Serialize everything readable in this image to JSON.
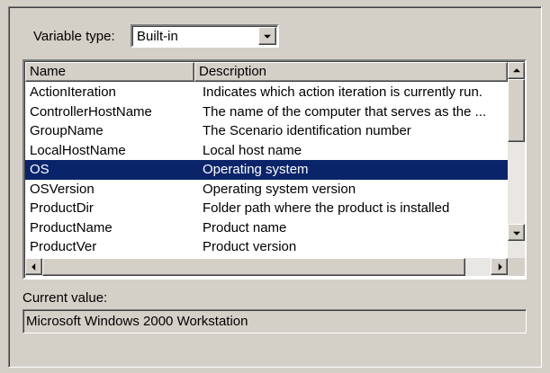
{
  "variable_type": {
    "label": "Variable type:",
    "selected": "Built-in"
  },
  "table": {
    "columns": [
      "Name",
      "Description"
    ],
    "rows": [
      {
        "name": "ActionIteration",
        "description": "Indicates which action iteration is currently run."
      },
      {
        "name": "ControllerHostName",
        "description": "The name of the computer that serves as the ..."
      },
      {
        "name": "GroupName",
        "description": "The Scenario identification number"
      },
      {
        "name": "LocalHostName",
        "description": "Local host name"
      },
      {
        "name": "OS",
        "description": "Operating system"
      },
      {
        "name": "OSVersion",
        "description": "Operating system version"
      },
      {
        "name": "ProductDir",
        "description": "Folder path where the product is installed"
      },
      {
        "name": "ProductName",
        "description": "Product name"
      },
      {
        "name": "ProductVer",
        "description": "Product version"
      }
    ],
    "selected_row": "OS"
  },
  "current_value": {
    "label": "Current value:",
    "value": "Microsoft Windows 2000 Workstation"
  },
  "colors": {
    "face": "#d4d0c8",
    "selection": "#0a246a"
  }
}
